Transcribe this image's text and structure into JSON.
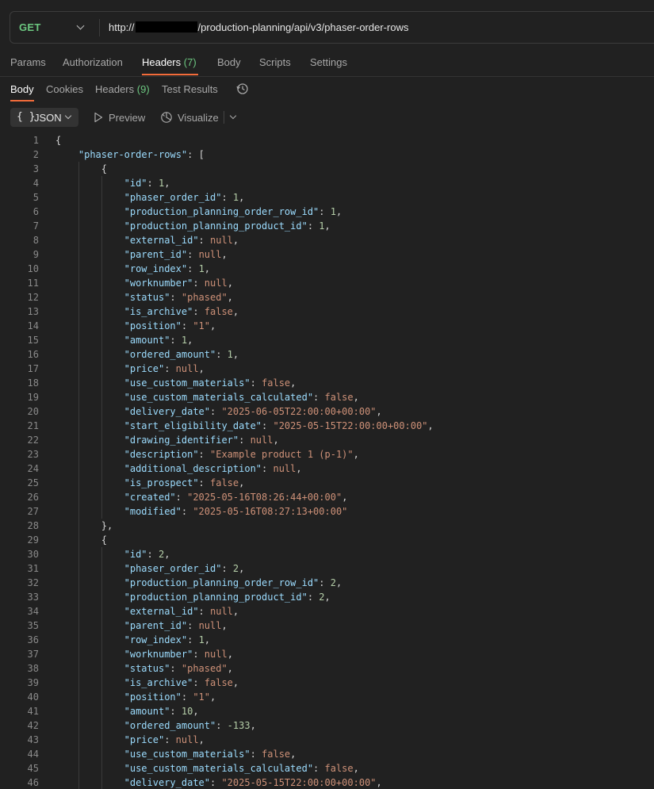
{
  "request": {
    "method": "GET",
    "url_prefix": "http://",
    "url_path": "/production-planning/api/v3/phaser-order-rows"
  },
  "request_tabs": [
    {
      "label": "Params",
      "count": ""
    },
    {
      "label": "Authorization",
      "count": ""
    },
    {
      "label": "Headers",
      "count": "(7)"
    },
    {
      "label": "Body",
      "count": ""
    },
    {
      "label": "Scripts",
      "count": ""
    },
    {
      "label": "Settings",
      "count": ""
    }
  ],
  "response_tabs": [
    {
      "label": "Body",
      "count": ""
    },
    {
      "label": "Cookies",
      "count": ""
    },
    {
      "label": "Headers",
      "count": "(9)"
    },
    {
      "label": "Test Results",
      "count": ""
    }
  ],
  "toolbar": {
    "braces": "{ }",
    "format_label": "JSON",
    "preview_label": "Preview",
    "visualize_label": "Visualize"
  },
  "icons": {
    "history": "history-icon",
    "play": "play-icon",
    "visualize": "visualize-icon",
    "chevron": "chevron-down-icon"
  },
  "colors": {
    "method_get": "#6cc780",
    "active_tab_underline": "#f26b3a",
    "json_key": "#9cdcfe",
    "json_string": "#ce9178",
    "json_number": "#b5cea8"
  },
  "code_lines": [
    {
      "n": "1",
      "indent": 0,
      "t": [
        [
          "p",
          "{"
        ]
      ]
    },
    {
      "n": "2",
      "indent": 1,
      "t": [
        [
          "k",
          "\"phaser-order-rows\""
        ],
        [
          "p",
          ": ["
        ]
      ]
    },
    {
      "n": "3",
      "indent": 2,
      "t": [
        [
          "p",
          "{"
        ]
      ]
    },
    {
      "n": "4",
      "indent": 3,
      "t": [
        [
          "k",
          "\"id\""
        ],
        [
          "p",
          ": "
        ],
        [
          "n",
          "1"
        ],
        [
          "p",
          ","
        ]
      ]
    },
    {
      "n": "5",
      "indent": 3,
      "t": [
        [
          "k",
          "\"phaser_order_id\""
        ],
        [
          "p",
          ": "
        ],
        [
          "n",
          "1"
        ],
        [
          "p",
          ","
        ]
      ]
    },
    {
      "n": "6",
      "indent": 3,
      "t": [
        [
          "k",
          "\"production_planning_order_row_id\""
        ],
        [
          "p",
          ": "
        ],
        [
          "n",
          "1"
        ],
        [
          "p",
          ","
        ]
      ]
    },
    {
      "n": "7",
      "indent": 3,
      "t": [
        [
          "k",
          "\"production_planning_product_id\""
        ],
        [
          "p",
          ": "
        ],
        [
          "n",
          "1"
        ],
        [
          "p",
          ","
        ]
      ]
    },
    {
      "n": "8",
      "indent": 3,
      "t": [
        [
          "k",
          "\"external_id\""
        ],
        [
          "p",
          ": "
        ],
        [
          "nl",
          "null"
        ],
        [
          "p",
          ","
        ]
      ]
    },
    {
      "n": "9",
      "indent": 3,
      "t": [
        [
          "k",
          "\"parent_id\""
        ],
        [
          "p",
          ": "
        ],
        [
          "nl",
          "null"
        ],
        [
          "p",
          ","
        ]
      ]
    },
    {
      "n": "10",
      "indent": 3,
      "t": [
        [
          "k",
          "\"row_index\""
        ],
        [
          "p",
          ": "
        ],
        [
          "n",
          "1"
        ],
        [
          "p",
          ","
        ]
      ]
    },
    {
      "n": "11",
      "indent": 3,
      "t": [
        [
          "k",
          "\"worknumber\""
        ],
        [
          "p",
          ": "
        ],
        [
          "nl",
          "null"
        ],
        [
          "p",
          ","
        ]
      ]
    },
    {
      "n": "12",
      "indent": 3,
      "t": [
        [
          "k",
          "\"status\""
        ],
        [
          "p",
          ": "
        ],
        [
          "s",
          "\"phased\""
        ],
        [
          "p",
          ","
        ]
      ]
    },
    {
      "n": "13",
      "indent": 3,
      "t": [
        [
          "k",
          "\"is_archive\""
        ],
        [
          "p",
          ": "
        ],
        [
          "b",
          "false"
        ],
        [
          "p",
          ","
        ]
      ]
    },
    {
      "n": "14",
      "indent": 3,
      "t": [
        [
          "k",
          "\"position\""
        ],
        [
          "p",
          ": "
        ],
        [
          "s",
          "\"1\""
        ],
        [
          "p",
          ","
        ]
      ]
    },
    {
      "n": "15",
      "indent": 3,
      "t": [
        [
          "k",
          "\"amount\""
        ],
        [
          "p",
          ": "
        ],
        [
          "n",
          "1"
        ],
        [
          "p",
          ","
        ]
      ]
    },
    {
      "n": "16",
      "indent": 3,
      "t": [
        [
          "k",
          "\"ordered_amount\""
        ],
        [
          "p",
          ": "
        ],
        [
          "n",
          "1"
        ],
        [
          "p",
          ","
        ]
      ]
    },
    {
      "n": "17",
      "indent": 3,
      "t": [
        [
          "k",
          "\"price\""
        ],
        [
          "p",
          ": "
        ],
        [
          "nl",
          "null"
        ],
        [
          "p",
          ","
        ]
      ]
    },
    {
      "n": "18",
      "indent": 3,
      "t": [
        [
          "k",
          "\"use_custom_materials\""
        ],
        [
          "p",
          ": "
        ],
        [
          "b",
          "false"
        ],
        [
          "p",
          ","
        ]
      ]
    },
    {
      "n": "19",
      "indent": 3,
      "t": [
        [
          "k",
          "\"use_custom_materials_calculated\""
        ],
        [
          "p",
          ": "
        ],
        [
          "b",
          "false"
        ],
        [
          "p",
          ","
        ]
      ]
    },
    {
      "n": "20",
      "indent": 3,
      "t": [
        [
          "k",
          "\"delivery_date\""
        ],
        [
          "p",
          ": "
        ],
        [
          "s",
          "\"2025-06-05T22:00:00+00:00\""
        ],
        [
          "p",
          ","
        ]
      ]
    },
    {
      "n": "21",
      "indent": 3,
      "t": [
        [
          "k",
          "\"start_eligibility_date\""
        ],
        [
          "p",
          ": "
        ],
        [
          "s",
          "\"2025-05-15T22:00:00+00:00\""
        ],
        [
          "p",
          ","
        ]
      ]
    },
    {
      "n": "22",
      "indent": 3,
      "t": [
        [
          "k",
          "\"drawing_identifier\""
        ],
        [
          "p",
          ": "
        ],
        [
          "nl",
          "null"
        ],
        [
          "p",
          ","
        ]
      ]
    },
    {
      "n": "23",
      "indent": 3,
      "t": [
        [
          "k",
          "\"description\""
        ],
        [
          "p",
          ": "
        ],
        [
          "s",
          "\"Example product 1 (p-1)\""
        ],
        [
          "p",
          ","
        ]
      ]
    },
    {
      "n": "24",
      "indent": 3,
      "t": [
        [
          "k",
          "\"additional_description\""
        ],
        [
          "p",
          ": "
        ],
        [
          "nl",
          "null"
        ],
        [
          "p",
          ","
        ]
      ]
    },
    {
      "n": "25",
      "indent": 3,
      "t": [
        [
          "k",
          "\"is_prospect\""
        ],
        [
          "p",
          ": "
        ],
        [
          "b",
          "false"
        ],
        [
          "p",
          ","
        ]
      ]
    },
    {
      "n": "26",
      "indent": 3,
      "t": [
        [
          "k",
          "\"created\""
        ],
        [
          "p",
          ": "
        ],
        [
          "s",
          "\"2025-05-16T08:26:44+00:00\""
        ],
        [
          "p",
          ","
        ]
      ]
    },
    {
      "n": "27",
      "indent": 3,
      "t": [
        [
          "k",
          "\"modified\""
        ],
        [
          "p",
          ": "
        ],
        [
          "s",
          "\"2025-05-16T08:27:13+00:00\""
        ]
      ]
    },
    {
      "n": "28",
      "indent": 2,
      "t": [
        [
          "p",
          "},"
        ]
      ]
    },
    {
      "n": "29",
      "indent": 2,
      "t": [
        [
          "p",
          "{"
        ]
      ]
    },
    {
      "n": "30",
      "indent": 3,
      "t": [
        [
          "k",
          "\"id\""
        ],
        [
          "p",
          ": "
        ],
        [
          "n",
          "2"
        ],
        [
          "p",
          ","
        ]
      ]
    },
    {
      "n": "31",
      "indent": 3,
      "t": [
        [
          "k",
          "\"phaser_order_id\""
        ],
        [
          "p",
          ": "
        ],
        [
          "n",
          "2"
        ],
        [
          "p",
          ","
        ]
      ]
    },
    {
      "n": "32",
      "indent": 3,
      "t": [
        [
          "k",
          "\"production_planning_order_row_id\""
        ],
        [
          "p",
          ": "
        ],
        [
          "n",
          "2"
        ],
        [
          "p",
          ","
        ]
      ]
    },
    {
      "n": "33",
      "indent": 3,
      "t": [
        [
          "k",
          "\"production_planning_product_id\""
        ],
        [
          "p",
          ": "
        ],
        [
          "n",
          "2"
        ],
        [
          "p",
          ","
        ]
      ]
    },
    {
      "n": "34",
      "indent": 3,
      "t": [
        [
          "k",
          "\"external_id\""
        ],
        [
          "p",
          ": "
        ],
        [
          "nl",
          "null"
        ],
        [
          "p",
          ","
        ]
      ]
    },
    {
      "n": "35",
      "indent": 3,
      "t": [
        [
          "k",
          "\"parent_id\""
        ],
        [
          "p",
          ": "
        ],
        [
          "nl",
          "null"
        ],
        [
          "p",
          ","
        ]
      ]
    },
    {
      "n": "36",
      "indent": 3,
      "t": [
        [
          "k",
          "\"row_index\""
        ],
        [
          "p",
          ": "
        ],
        [
          "n",
          "1"
        ],
        [
          "p",
          ","
        ]
      ]
    },
    {
      "n": "37",
      "indent": 3,
      "t": [
        [
          "k",
          "\"worknumber\""
        ],
        [
          "p",
          ": "
        ],
        [
          "nl",
          "null"
        ],
        [
          "p",
          ","
        ]
      ]
    },
    {
      "n": "38",
      "indent": 3,
      "t": [
        [
          "k",
          "\"status\""
        ],
        [
          "p",
          ": "
        ],
        [
          "s",
          "\"phased\""
        ],
        [
          "p",
          ","
        ]
      ]
    },
    {
      "n": "39",
      "indent": 3,
      "t": [
        [
          "k",
          "\"is_archive\""
        ],
        [
          "p",
          ": "
        ],
        [
          "b",
          "false"
        ],
        [
          "p",
          ","
        ]
      ]
    },
    {
      "n": "40",
      "indent": 3,
      "t": [
        [
          "k",
          "\"position\""
        ],
        [
          "p",
          ": "
        ],
        [
          "s",
          "\"1\""
        ],
        [
          "p",
          ","
        ]
      ]
    },
    {
      "n": "41",
      "indent": 3,
      "t": [
        [
          "k",
          "\"amount\""
        ],
        [
          "p",
          ": "
        ],
        [
          "n",
          "10"
        ],
        [
          "p",
          ","
        ]
      ]
    },
    {
      "n": "42",
      "indent": 3,
      "t": [
        [
          "k",
          "\"ordered_amount\""
        ],
        [
          "p",
          ": "
        ],
        [
          "n",
          "-133"
        ],
        [
          "p",
          ","
        ]
      ]
    },
    {
      "n": "43",
      "indent": 3,
      "t": [
        [
          "k",
          "\"price\""
        ],
        [
          "p",
          ": "
        ],
        [
          "nl",
          "null"
        ],
        [
          "p",
          ","
        ]
      ]
    },
    {
      "n": "44",
      "indent": 3,
      "t": [
        [
          "k",
          "\"use_custom_materials\""
        ],
        [
          "p",
          ": "
        ],
        [
          "b",
          "false"
        ],
        [
          "p",
          ","
        ]
      ]
    },
    {
      "n": "45",
      "indent": 3,
      "t": [
        [
          "k",
          "\"use_custom_materials_calculated\""
        ],
        [
          "p",
          ": "
        ],
        [
          "b",
          "false"
        ],
        [
          "p",
          ","
        ]
      ]
    },
    {
      "n": "46",
      "indent": 3,
      "t": [
        [
          "k",
          "\"delivery_date\""
        ],
        [
          "p",
          ": "
        ],
        [
          "s",
          "\"2025-05-15T22:00:00+00:00\""
        ],
        [
          "p",
          ","
        ]
      ]
    }
  ]
}
